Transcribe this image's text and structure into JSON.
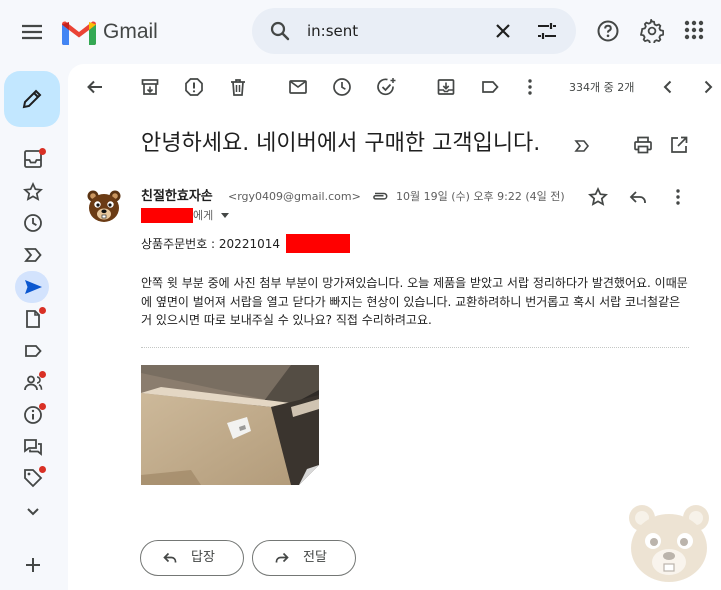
{
  "header": {
    "logo_text": "Gmail",
    "search_query": "in:sent"
  },
  "toolbar": {
    "page_count": "334개 중 2개"
  },
  "message": {
    "subject": "안녕하세요. 네이버에서 구매한 고객입니다.",
    "sender_name": "친절한효자손",
    "sender_email": "<rgy0409@gmail.com>",
    "date": "10월 19일 (수) 오후 9:22 (4일 전)",
    "to_suffix": "에게",
    "order_label": "상품주문번호 : 20221014",
    "body": "안쪽 윗 부분 중에 사진 첨부 부분이 망가져있습니다. 오늘 제품을 받았고 서랍 정리하다가 발견했어요. 이때문에 옆면이 벌어져 서랍을 열고 닫다가 빠지는 현상이 있습니다. 교환하려하니 번거롭고 혹시 서랍 코너철같은거 있으시면 따로 보내주실 수 있나요? 직접 수리하려고요."
  },
  "actions": {
    "reply_label": "답장",
    "forward_label": "전달"
  },
  "colors": {
    "background": "#f6f8fc",
    "compose": "#c2e7ff",
    "active_nav": "#d3e3fd",
    "redaction": "#ff0000",
    "badge": "#d93025"
  }
}
